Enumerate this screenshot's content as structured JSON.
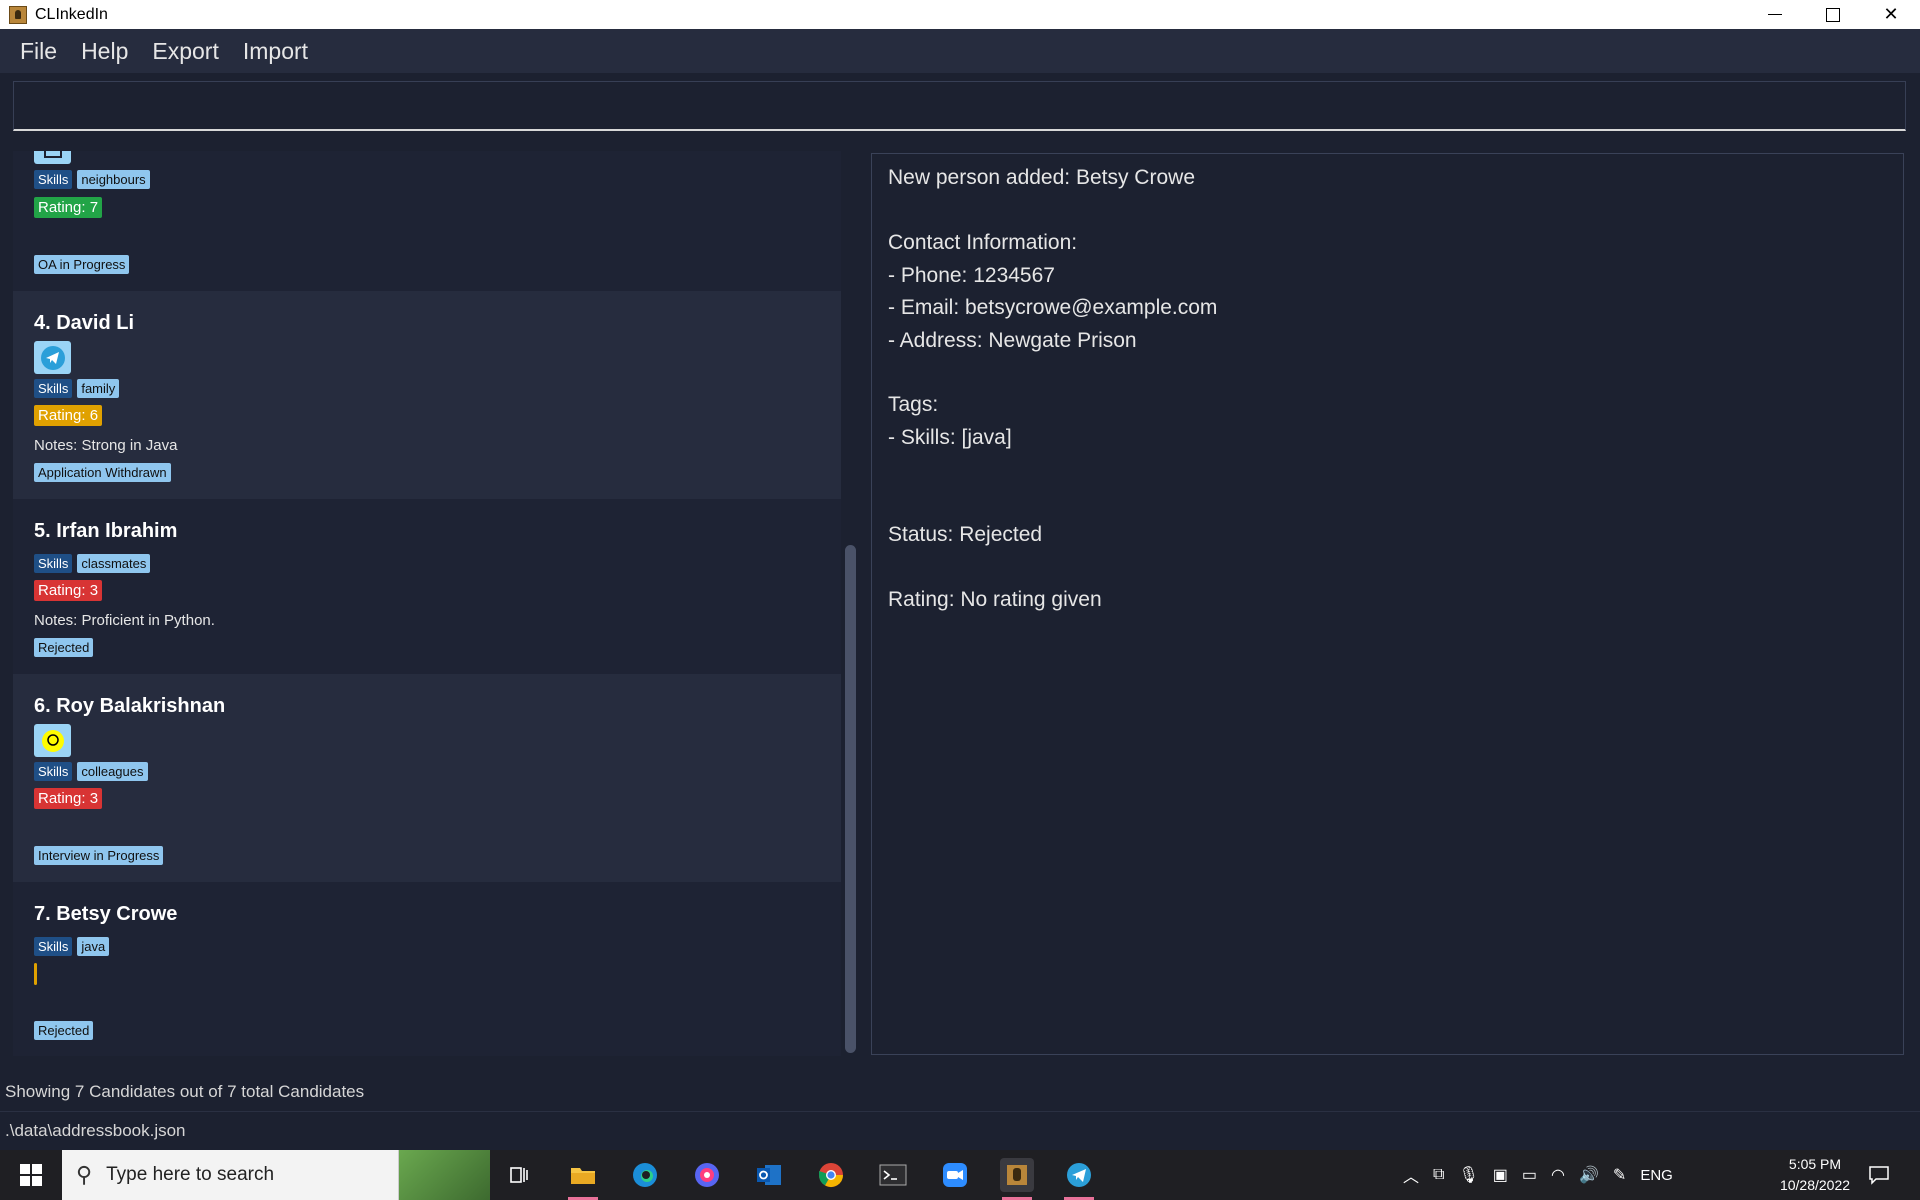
{
  "window": {
    "title": "CLInkedIn"
  },
  "menu": [
    "File",
    "Help",
    "Export",
    "Import"
  ],
  "command_box": {
    "value": "",
    "placeholder": ""
  },
  "candidates": [
    {
      "name": "",
      "social_icon": "generic-icon",
      "tags": [
        {
          "label": "Skills"
        },
        {
          "label": "neighbours"
        }
      ],
      "rating": "Rating: 7",
      "rating_color": "#22a447",
      "notes": "",
      "status": "OA in Progress"
    },
    {
      "name": "4.  David Li",
      "social_icon": "telegram-icon",
      "tags": [
        {
          "label": "Skills"
        },
        {
          "label": "family"
        }
      ],
      "rating": "Rating: 6",
      "rating_color": "#e0a100",
      "notes": "Notes: Strong in Java",
      "status": "Application Withdrawn"
    },
    {
      "name": "5.  Irfan Ibrahim",
      "social_icon": "",
      "tags": [
        {
          "label": "Skills"
        },
        {
          "label": "classmates"
        }
      ],
      "rating": "Rating: 3",
      "rating_color": "#d83434",
      "notes": "Notes: Proficient in Python.",
      "status": "Rejected"
    },
    {
      "name": "6.  Roy Balakrishnan",
      "social_icon": "snapchat-icon",
      "tags": [
        {
          "label": "Skills"
        },
        {
          "label": "colleagues"
        }
      ],
      "rating": "Rating: 3",
      "rating_color": "#d83434",
      "notes": "",
      "status": "Interview in Progress"
    },
    {
      "name": "7.  Betsy Crowe",
      "social_icon": "",
      "tags": [
        {
          "label": "Skills"
        },
        {
          "label": "java"
        }
      ],
      "rating": "",
      "rating_color": "#e0a100",
      "notes": "",
      "status": "Rejected"
    }
  ],
  "detail": {
    "added": "New person added: Betsy Crowe",
    "contact_header": "Contact Information:",
    "phone": "- Phone: 1234567",
    "email": "- Email: betsycrowe@example.com",
    "address": "- Address: Newgate Prison",
    "tags_header": "Tags:",
    "skills": "- Skills: [java]",
    "status": "Status: Rejected",
    "rating": "Rating: No rating given"
  },
  "status_bar": {
    "count": "Showing  7  Candidates out of  7  total Candidates",
    "file_path": ".\\data\\addressbook.json"
  },
  "taskbar": {
    "search_placeholder": "Type here to search",
    "tray_language": "ENG",
    "time": "5:05 PM",
    "date": "10/28/2022"
  },
  "colors": {
    "background": "#1c2130",
    "card_alt": "#262c3e",
    "tag_skills": "#1f4f86",
    "tag_value": "#8fc6ee"
  }
}
